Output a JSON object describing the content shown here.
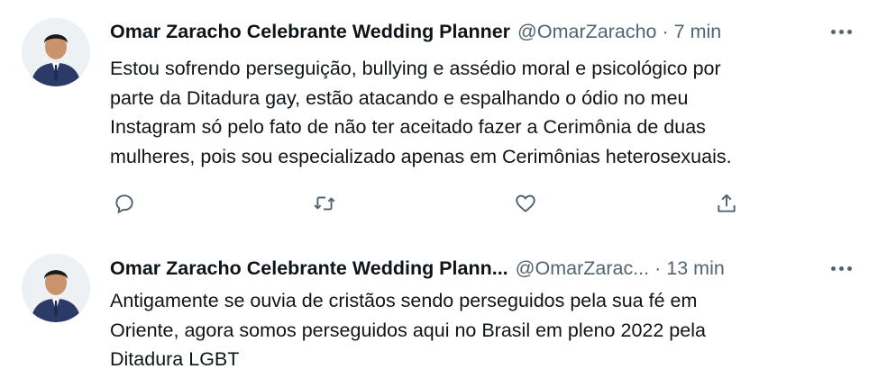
{
  "tweets": [
    {
      "author_name": "Omar Zaracho Celebrante Wedding Planner",
      "handle": "@OmarZaracho",
      "separator": "·",
      "time": "7 min",
      "text_lines": [
        "Estou sofrendo perseguição, bullying e assédio moral e psicológico por",
        "parte da Ditadura gay, estão atacando e espalhando o ódio no meu",
        "Instagram só pelo fato de não ter aceitado fazer a Cerimônia de duas",
        "mulheres, pois sou especializado apenas em Cerimônias heterosexuais."
      ]
    },
    {
      "author_name": "Omar Zaracho Celebrante Wedding Plann...",
      "handle": "@OmarZarac...",
      "separator": "·",
      "time": "13 min",
      "text_lines": [
        "Antigamente se ouvia de cristãos sendo perseguidos pela sua fé em",
        "Oriente, agora somos perseguidos aqui no Brasil em pleno 2022 pela",
        "Ditadura LGBT"
      ]
    }
  ],
  "icons": {
    "reply": "reply-icon",
    "retweet": "retweet-icon",
    "like": "heart-icon",
    "share": "share-icon",
    "more": "more-icon"
  },
  "colors": {
    "text": "#0f1419",
    "secondary": "#536471"
  }
}
